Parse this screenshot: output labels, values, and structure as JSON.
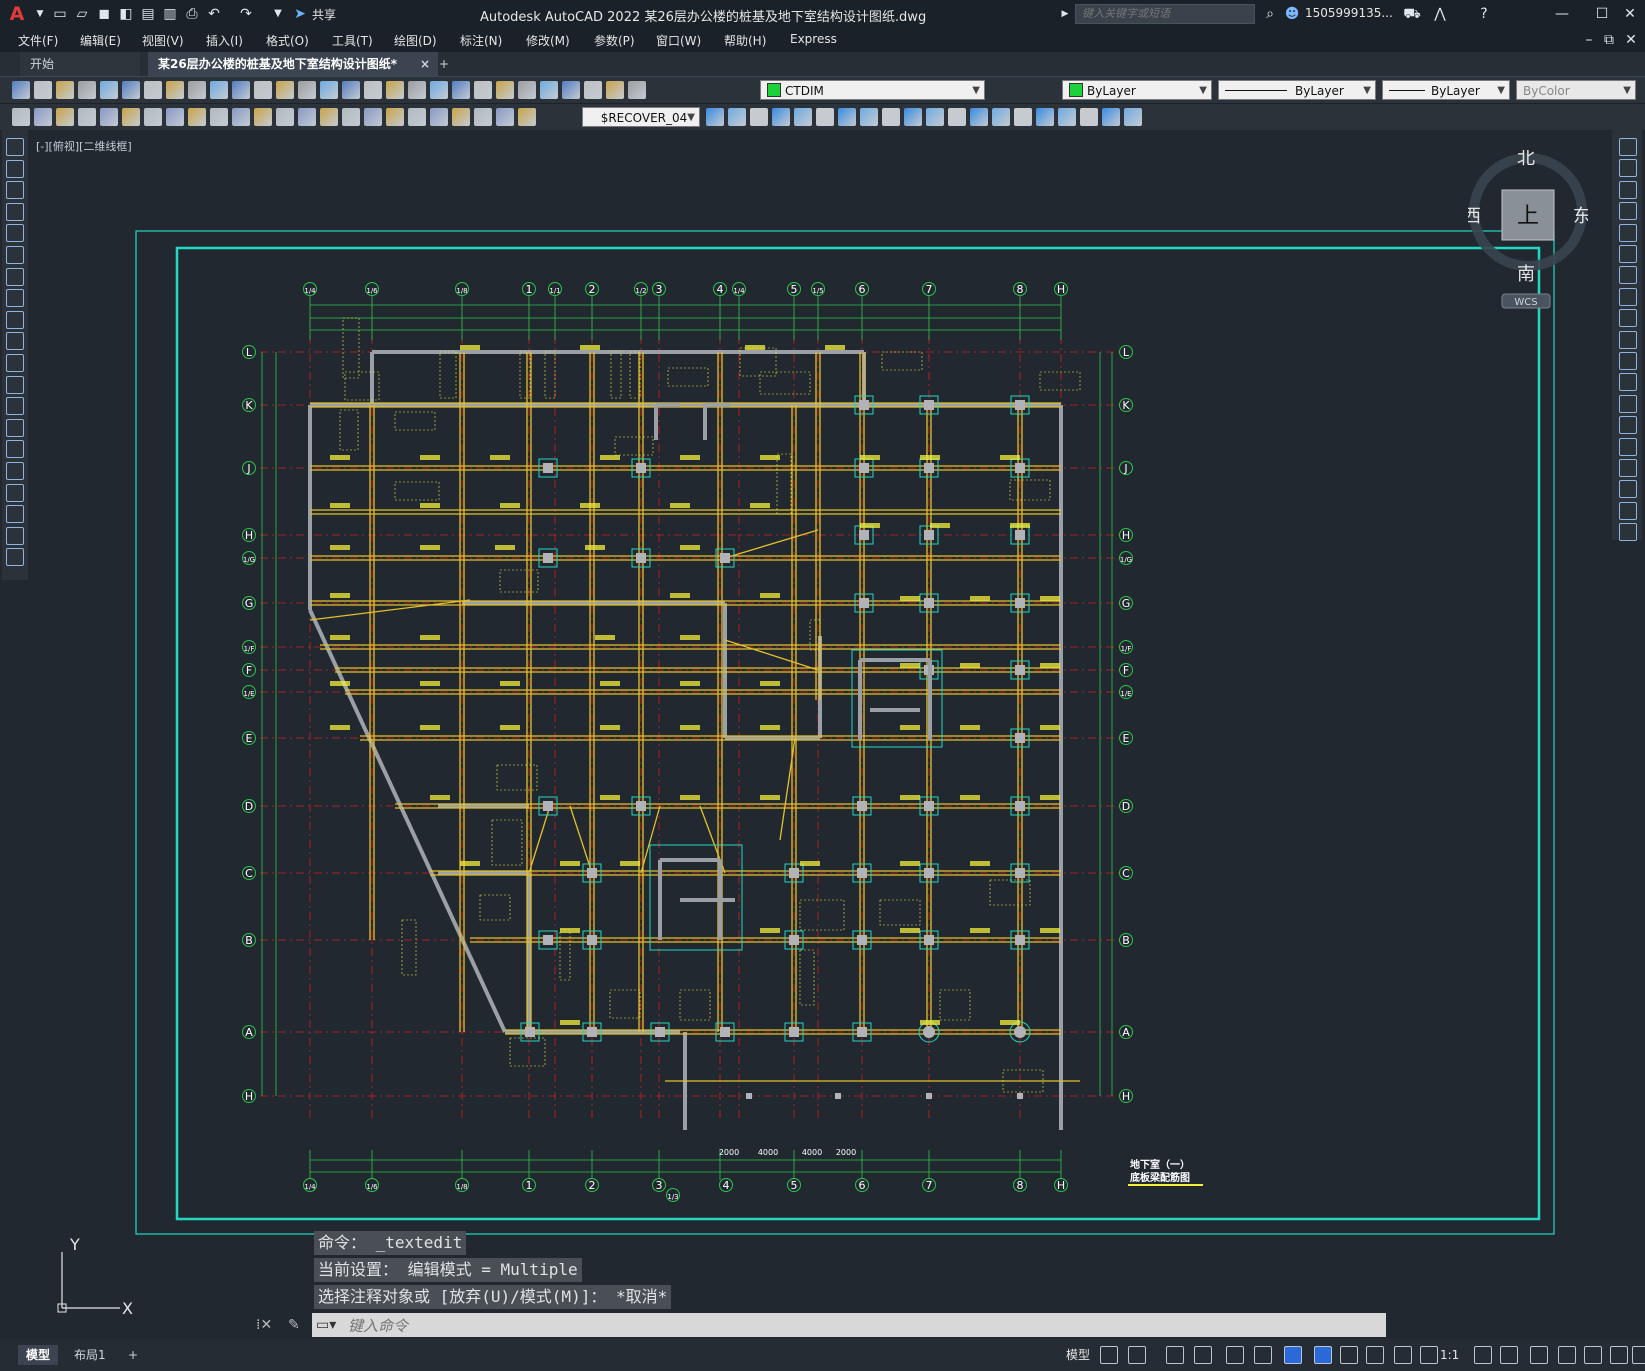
{
  "app": {
    "logo": "A",
    "title": "Autodesk AutoCAD 2022    某26层办公楼的桩基及地下室结构设计图纸.dwg",
    "share_label": "共享",
    "search_placeholder": "键入关键字或短语",
    "user": "1505999135...",
    "help_icon": "?"
  },
  "menus": [
    "文件(F)",
    "编辑(E)",
    "视图(V)",
    "插入(I)",
    "格式(O)",
    "工具(T)",
    "绘图(D)",
    "标注(N)",
    "修改(M)",
    "参数(P)",
    "窗口(W)",
    "帮助(H)",
    "Express"
  ],
  "tabs": {
    "start": "开始",
    "document": "某26层办公楼的桩基及地下室结构设计图纸*",
    "close": "×",
    "add": "+"
  },
  "toolbar": {
    "layer_select": "CTDIM",
    "color_select": "ByLayer",
    "linetype_select": "ByLayer",
    "lineweight_select": "ByLayer",
    "plotstyle_select": "ByColor",
    "dimstyle_select": "$RECOVER_04"
  },
  "viewport": {
    "label": "[-][俯视][二维线框]"
  },
  "viewcube": {
    "north": "北",
    "south": "南",
    "east": "东",
    "west": "西",
    "face": "上",
    "wcs": "WCS"
  },
  "drawing": {
    "top_axes": [
      "1/4",
      "1/6",
      "1/8",
      "1",
      "1/1",
      "2",
      "1/2",
      "3",
      "4",
      "1/4",
      "5",
      "1/5",
      "6",
      "7",
      "8",
      "H"
    ],
    "bottom_axes": [
      "1/4",
      "1/6",
      "1/8",
      "1",
      "2",
      "3",
      "1/3",
      "4",
      "5",
      "6",
      "7",
      "8",
      "H"
    ],
    "rows": [
      "L",
      "K",
      "J",
      "H",
      "1/G",
      "G",
      "1/F",
      "F",
      "1/E",
      "E",
      "D",
      "C",
      "B",
      "A",
      "H"
    ],
    "dims": [
      "2000",
      "4000",
      "4000",
      "2000"
    ],
    "title_line1": "地下室（一）",
    "title_line2": "底板梁配筋图"
  },
  "ucs": {
    "x": "X",
    "y": "Y"
  },
  "command": {
    "history": [
      "命令：  _textedit",
      "当前设置：  编辑模式 = Multiple",
      "选择注释对象或 [放弃(U)/模式(M)]： *取消*"
    ],
    "placeholder": "键入命令"
  },
  "status": {
    "tab_model": "模型",
    "tab_layout": "布局1",
    "add": "+",
    "model_button": "模型",
    "scale": "1:1"
  },
  "colors": {
    "background": "#212830",
    "frame": "#22d8c0",
    "beam": "#e3c12a",
    "gridline": "#d21e1e",
    "dim": "#2cc44a",
    "text": "#f4ef3a"
  }
}
